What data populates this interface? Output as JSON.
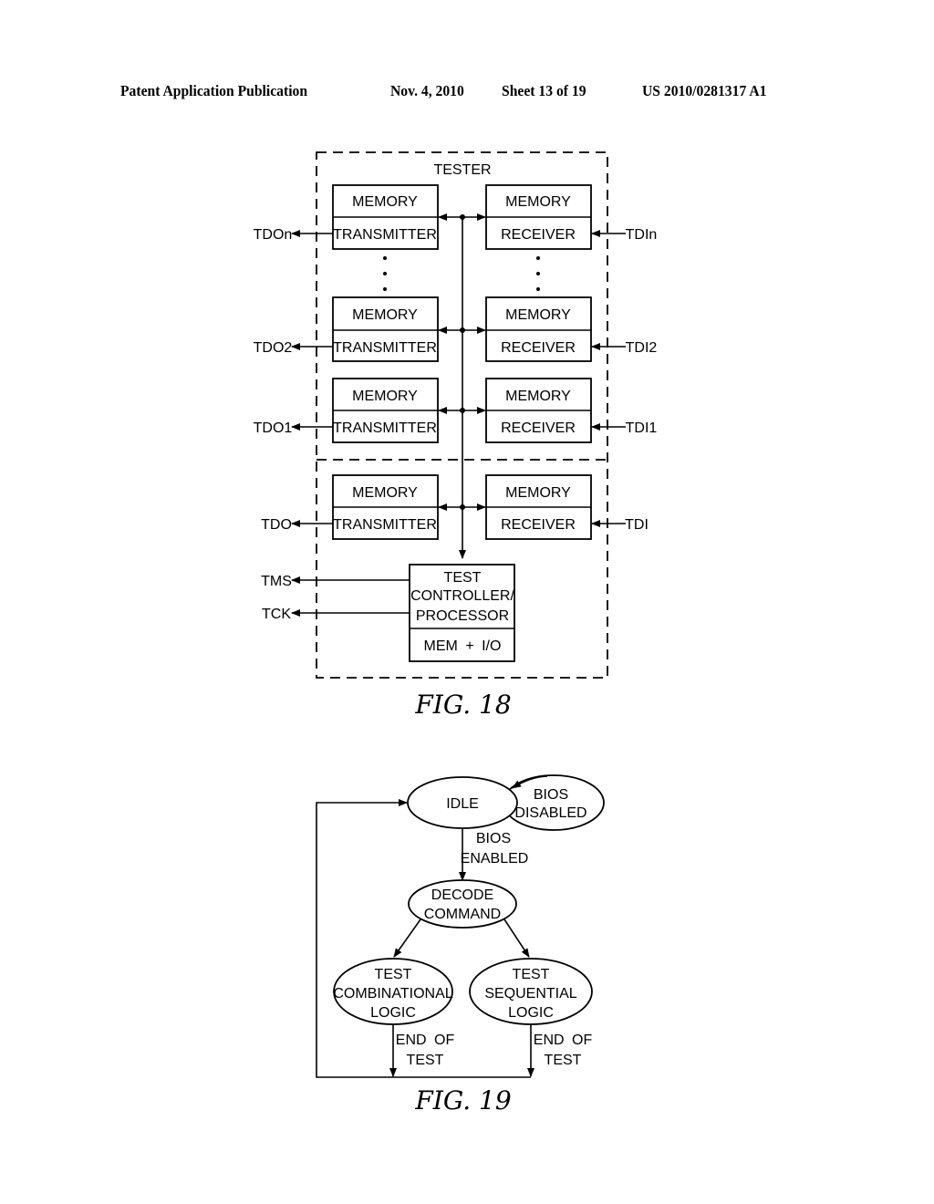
{
  "header": {
    "publication": "Patent Application Publication",
    "date": "Nov. 4, 2010",
    "sheet": "Sheet 13 of 19",
    "number": "US 2010/0281317 A1"
  },
  "fig18": {
    "caption": "FIG. 18",
    "tester_label": "TESTER",
    "rows": [
      {
        "left_top": "MEMORY",
        "left_bottom": "TRANSMITTER",
        "right_top": "MEMORY",
        "right_bottom": "RECEIVER",
        "out": "TDOn",
        "in": "TDIn"
      },
      {
        "left_top": "MEMORY",
        "left_bottom": "TRANSMITTER",
        "right_top": "MEMORY",
        "right_bottom": "RECEIVER",
        "out": "TDO2",
        "in": "TDI2"
      },
      {
        "left_top": "MEMORY",
        "left_bottom": "TRANSMITTER",
        "right_top": "MEMORY",
        "right_bottom": "RECEIVER",
        "out": "TDO1",
        "in": "TDI1"
      },
      {
        "left_top": "MEMORY",
        "left_bottom": "TRANSMITTER",
        "right_top": "MEMORY",
        "right_bottom": "RECEIVER",
        "out": "TDO",
        "in": "TDI"
      }
    ],
    "controller": {
      "line1": "TEST",
      "line2": "CONTROLLER/",
      "line3": "PROCESSOR",
      "bottom": "MEM + I/O"
    },
    "signals": {
      "tms": "TMS",
      "tck": "TCK"
    }
  },
  "fig19": {
    "caption": "FIG. 19",
    "states": {
      "idle": "IDLE",
      "bios_disabled": [
        "BIOS",
        "DISABLED"
      ],
      "decode": [
        "DECODE",
        "COMMAND"
      ],
      "comb": [
        "TEST",
        "COMBINATIONAL",
        "LOGIC"
      ],
      "seq": [
        "TEST",
        "SEQUENTIAL",
        "LOGIC"
      ]
    },
    "transitions": {
      "bios_enabled": [
        "BIOS",
        "ENABLED"
      ],
      "end_of_test_left": [
        "END OF",
        "TEST"
      ],
      "end_of_test_right": [
        "END OF",
        "TEST"
      ]
    }
  }
}
